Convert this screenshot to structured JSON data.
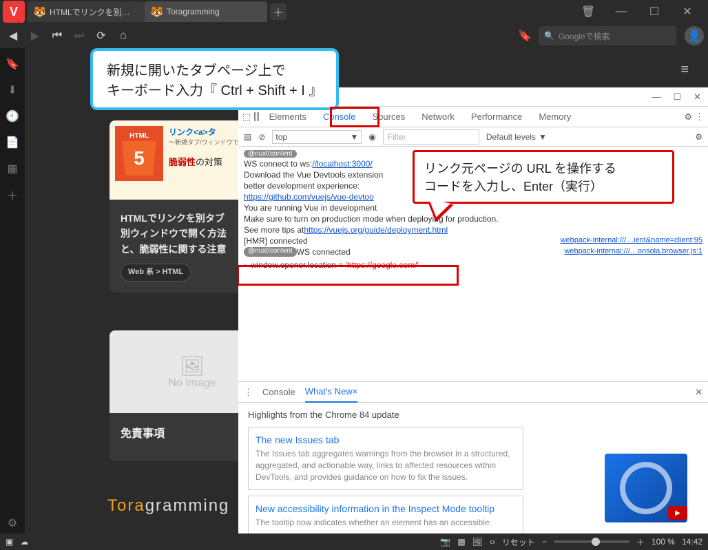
{
  "tabs": {
    "inactive": "HTMLでリンクを別タブ・別ウィ",
    "active": "Toragramming"
  },
  "window_controls": {
    "trash": "🗑",
    "min": "—",
    "max": "☐",
    "close": "✕"
  },
  "nav": {
    "search_placeholder": "Googleで検索"
  },
  "callout1_line1": "新規に開いたタブページ上で",
  "callout1_line2": "キーボード入力『 Ctrl + Shift + I 』",
  "callout2_line1": "リンク元ページの URL を操作する",
  "callout2_line2": "コードを入力し、Enter（実行）",
  "article": {
    "badge_top": "HTML",
    "badge_num": "5",
    "hero_link": "リンク<a>タ",
    "hero_sub": "～新規タブ/ウィンドウで開",
    "hero_warn_red": "脆弱性",
    "hero_warn_rest": "の対策",
    "body_l1": "HTMLでリンクを別タブ",
    "body_l2": "別ウィンドウで開く方法",
    "body_l3": "と、脆弱性に関する注意",
    "tag": "Web 系 > HTML"
  },
  "noimage": {
    "label": "No Image",
    "title": "免責事項"
  },
  "brand": {
    "t": "Tora",
    "rest": "gramming"
  },
  "devtools": {
    "url": "://localhost:3000/",
    "tabs": {
      "elements": "Elements",
      "console": "Console",
      "sources": "Sources",
      "network": "Network",
      "performance": "Performance",
      "memory": "Memory"
    },
    "toolbar": {
      "top": "top",
      "filter": "Filter",
      "levels": "Default levels"
    },
    "console_lines": {
      "badge1": "@nuxt/content",
      "ws": "WS connect to ws:",
      "ws_link": "//localhost:3000/",
      "dl1": "Download the Vue Devtools extension",
      "dl2": "better development experience:",
      "dl_link": "https://github.com/vuejs/vue-devtoo",
      "run1": "You are running Vue in development",
      "run2": "Make sure to turn on production mode when deploying for production.",
      "run3": "See more tips at ",
      "run3_link": "https://vuejs.org/guide/deployment.html",
      "hmr": "[HMR] connected",
      "hmr_src": "webpack-internal:///…ient&name=client:95",
      "badge2": "@nuxt/content",
      "ws2": " WS connected",
      "ws2_src": "webpack-internal:///…onsola.browser.js:1",
      "input_pre": "window.opener.location = ",
      "input_str": "'https://google.com/'"
    },
    "drawer": {
      "console": "Console",
      "whatsnew": "What's New",
      "highlights": "Highlights from the Chrome 84 update",
      "card1_title": "The new Issues tab",
      "card1_body": "The Issues tab aggregates warnings from the browser in a structured, aggregated, and actionable way, links to affected resources within DevTools, and provides guidance on how to fix the issues.",
      "card2_title": "New accessibility information in the Inspect Mode tooltip",
      "card2_body": "The tooltip now indicates whether an element has an accessible"
    }
  },
  "statusbar": {
    "reset": "リセット",
    "zoom": "100 %",
    "time": "14:42"
  }
}
